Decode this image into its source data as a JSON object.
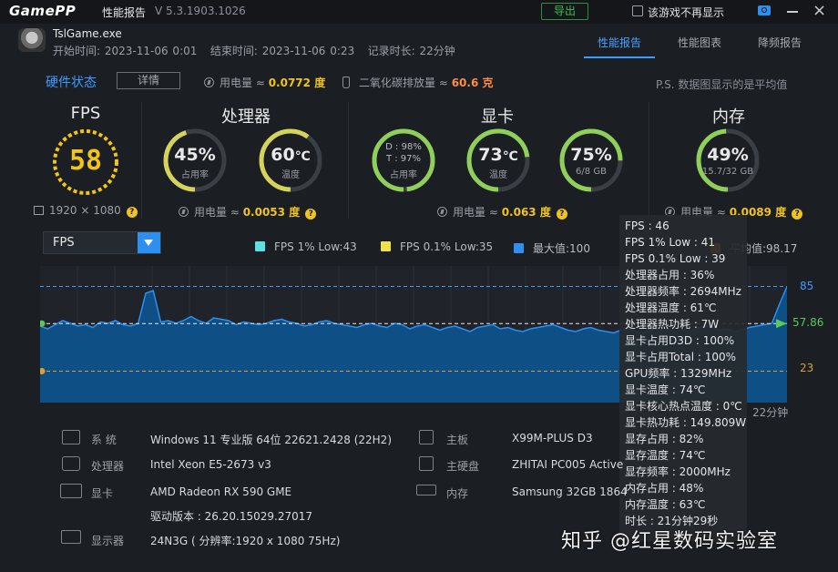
{
  "titlebar": {
    "logo": "GamePP",
    "title": "性能报告",
    "version": "V 5.3.1903.1026",
    "export_label": "导出",
    "no_show_label": "该游戏不再显示"
  },
  "session": {
    "game": "TslGame.exe",
    "start_label": "开始时间:",
    "start": "2023-11-06 0:01",
    "end_label": "结束时间:",
    "end": "2023-11-06 0:23",
    "duration_label": "记录时长:",
    "duration": "22分钟"
  },
  "tabs": [
    "性能报告",
    "性能图表",
    "降频报告"
  ],
  "hardware": {
    "title": "硬件状态",
    "detail_label": "详情",
    "power_label": "用电量 ≈",
    "power_value": "0.0772 度",
    "co2_label": "二氧化碳排放量 ≈",
    "co2_value": "60.6 克",
    "note": "P.S. 数据图显示的是平均值"
  },
  "sections": {
    "fps": "FPS",
    "cpu": "处理器",
    "gpu": "显卡",
    "mem": "内存"
  },
  "gauges": {
    "fps_value": "58",
    "fps_progress": 0.58,
    "resolution": "1920 × 1080",
    "cpu_usage": "45%",
    "cpu_usage_label": "占用率",
    "cpu_usage_progress": 0.45,
    "cpu_temp": "60",
    "cpu_temp_unit": "℃",
    "cpu_temp_label": "温度",
    "cpu_temp_progress": 0.6,
    "cpu_power_label": "用电量 ≈",
    "cpu_power": "0.0053 度",
    "gpu_d": "D : 98%",
    "gpu_t": "T : 97%",
    "gpu_usage_label": "占用率",
    "gpu_usage_progress": 0.98,
    "gpu_temp": "73",
    "gpu_temp_unit": "℃",
    "gpu_temp_label": "温度",
    "gpu_temp_progress": 0.73,
    "gpu_vram": "75%",
    "gpu_vram_label": "6/8 GB",
    "gpu_vram_progress": 0.75,
    "gpu_power_label": "用电量 ≈",
    "gpu_power": "0.063 度",
    "mem_usage": "49%",
    "mem_usage_label": "15.7/32 GB",
    "mem_usage_progress": 0.49,
    "mem_power_label": "用电量 ≈",
    "mem_power": "0.0089 度"
  },
  "chart_controls": {
    "metric": "FPS",
    "legend": [
      {
        "label": "FPS 1% Low:43",
        "color": "#5de0e0"
      },
      {
        "label": "FPS 0.1% Low:35",
        "color": "#f0e04a"
      },
      {
        "label": "最大值:100",
        "color": "#2d8ff0"
      },
      {
        "label": "平均值:98.17",
        "color": "#f0a020"
      }
    ]
  },
  "chart_data": {
    "type": "area",
    "x_end_label": "22分钟",
    "max_label": "85",
    "avg_label": "57.86",
    "min_label": "23",
    "max": 85,
    "avg": 57.86,
    "min": 23,
    "ylim": [
      0,
      100
    ],
    "values": [
      56,
      54,
      57,
      60,
      58,
      56,
      57,
      55,
      59,
      58,
      60,
      57,
      56,
      58,
      80,
      82,
      59,
      60,
      58,
      60,
      63,
      60,
      58,
      62,
      61,
      60,
      57,
      59,
      58,
      57,
      58,
      60,
      61,
      59,
      58,
      56,
      57,
      59,
      60,
      58,
      57,
      56,
      55,
      57,
      58,
      56,
      55,
      58,
      57,
      54,
      56,
      57,
      55,
      53,
      55,
      56,
      54,
      52,
      55,
      56,
      57,
      54,
      55,
      53,
      52,
      54,
      55,
      56,
      57,
      55,
      53,
      52,
      54,
      55,
      53,
      52,
      51,
      53,
      54,
      52,
      51,
      53,
      55,
      54,
      52,
      53,
      52,
      54,
      56,
      55,
      53,
      54,
      52,
      53,
      55,
      56,
      57,
      58,
      72,
      85
    ]
  },
  "tooltip": [
    "FPS : 46",
    "FPS 1% Low : 41",
    "FPS 0.1% Low : 39",
    "处理器占用 : 36%",
    "处理器频率 : 2694MHz",
    "处理器温度 : 61℃",
    "处理器热功耗 : 7W",
    "显卡占用D3D : 100%",
    "显卡占用Total : 100%",
    "GPU频率 : 1329MHz",
    "显卡温度 : 74℃",
    "显卡核心热点温度 : 0℃",
    "显卡热功耗 : 149.809W",
    "显存占用 : 82%",
    "显存温度 : 74℃",
    "显存频率 : 2000MHz",
    "内存占用 : 48%",
    "内存温度 : 63℃",
    "时长 : 21分钟29秒"
  ],
  "sysinfo": {
    "os_label": "系  统",
    "os": "Windows 11 专业版 64位 22621.2428 (22H2)",
    "cpu_label": "处理器",
    "cpu": "Intel Xeon E5-2673 v3",
    "gpu_label": "显卡",
    "gpu": "AMD Radeon RX 590 GME",
    "driver": "驱动版本 : 26.20.15029.27017",
    "monitor_label": "显示器",
    "monitor": "24N3G ( 分辨率:1920 x 1080 75Hz)",
    "board_label": "主板",
    "board": "X99M-PLUS D3",
    "disk_label": "主硬盘",
    "disk": "ZHITAI PC005 Active",
    "ram_label": "内存",
    "ram": "Samsung 32GB 1864"
  },
  "watermark": "知乎 @红星数码实验室",
  "colors": {
    "accent": "#2d8ff0",
    "fps_yellow": "#f0c419",
    "gauge_green": "#8fcf5a",
    "gauge_yellow": "#d4d45a",
    "track": "#3a3f46"
  }
}
